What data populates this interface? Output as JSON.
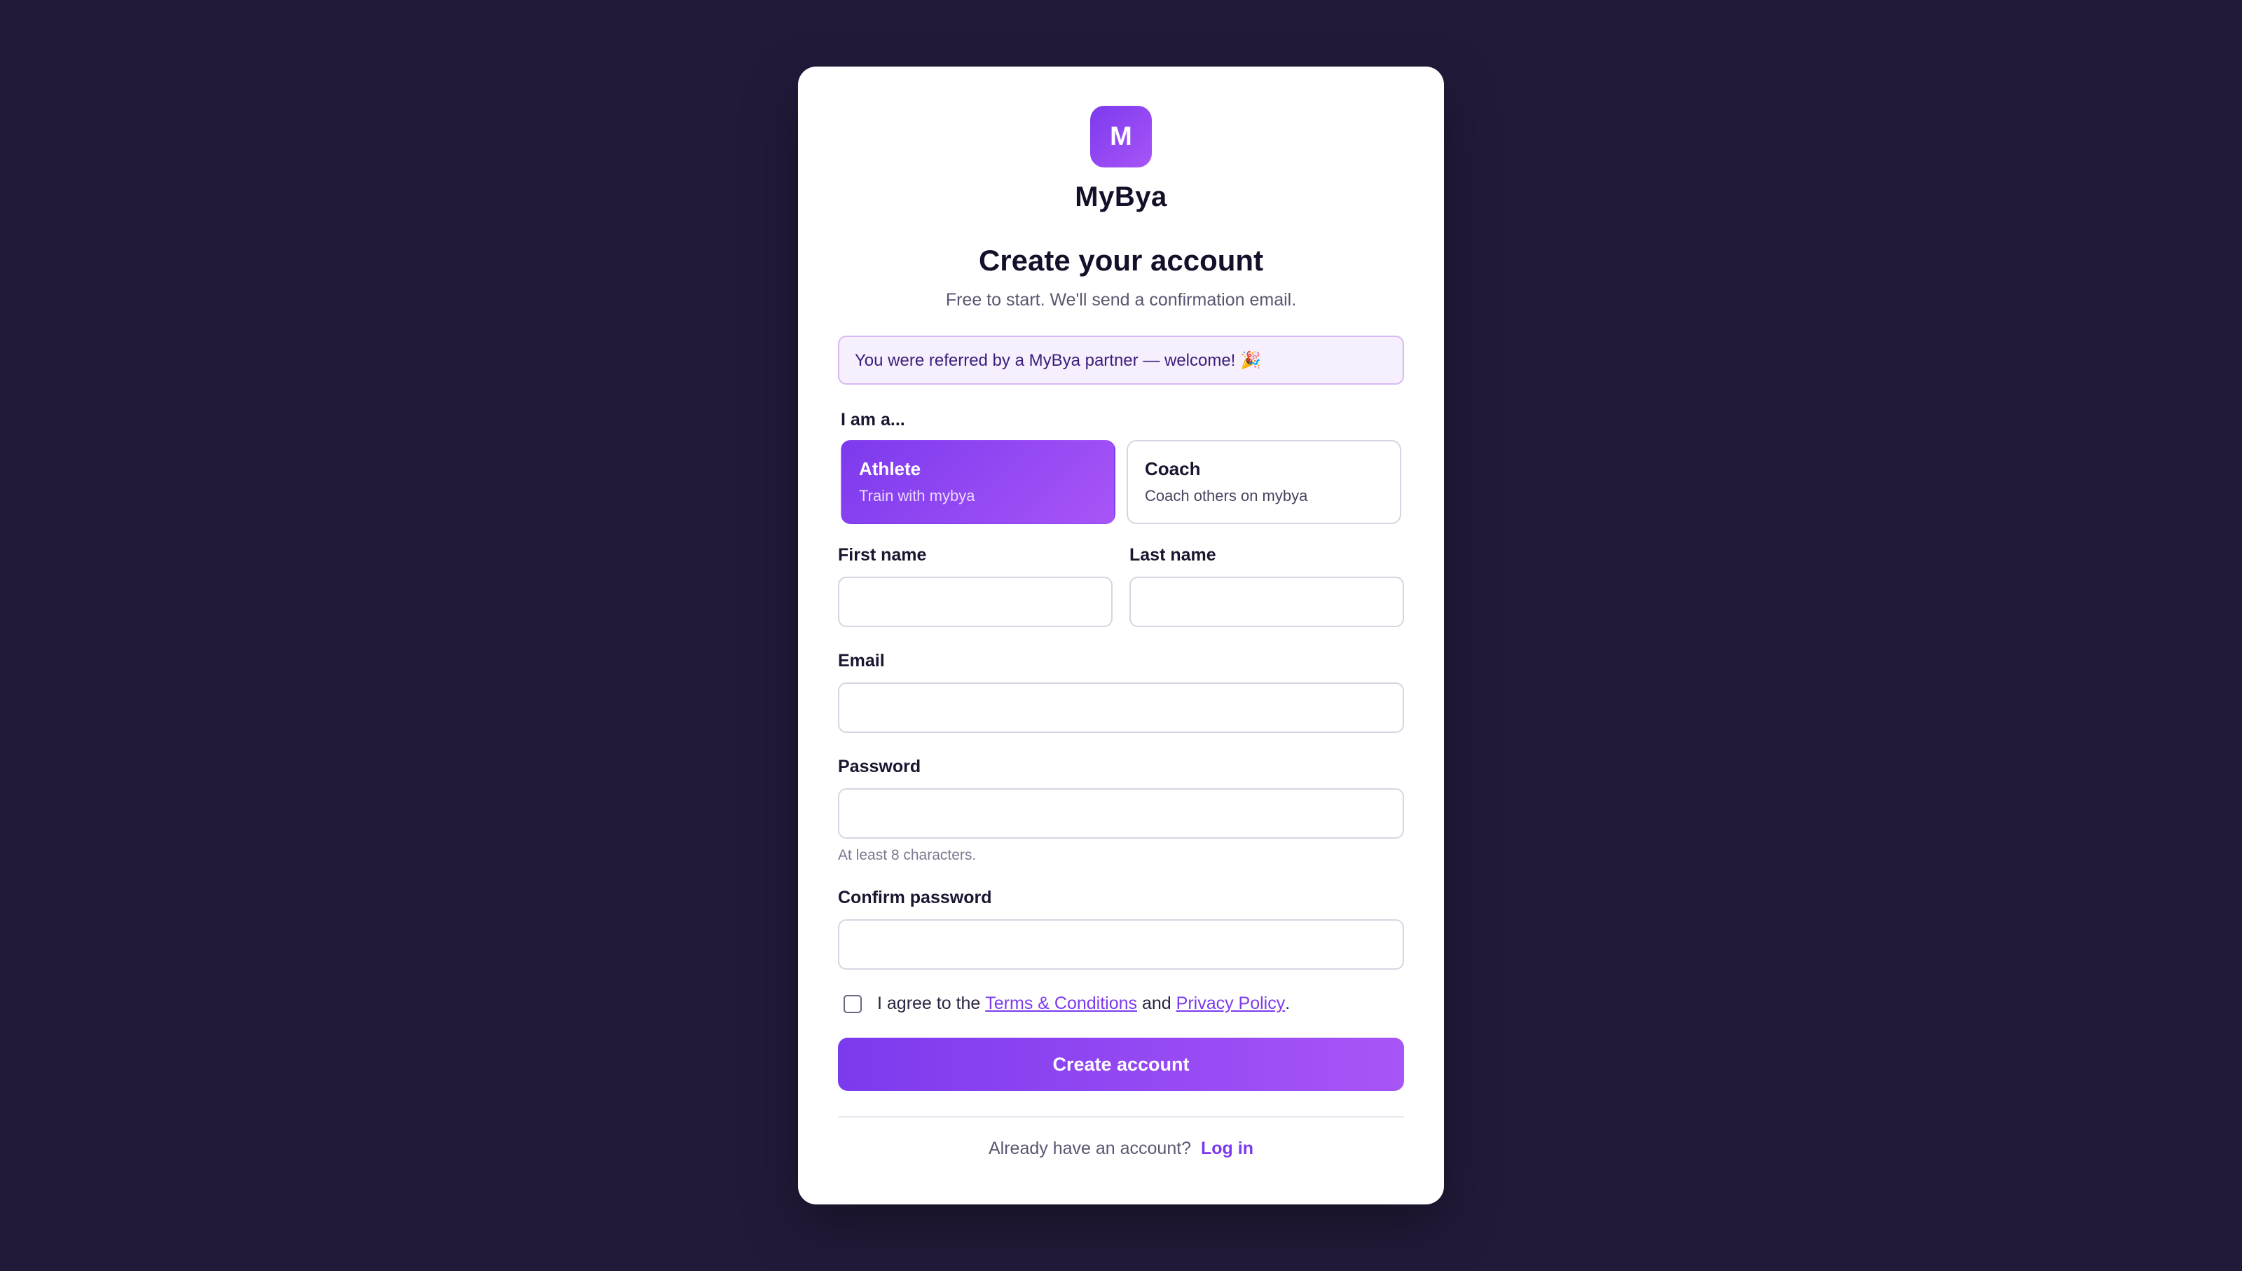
{
  "brand": {
    "logo_letter": "M",
    "name": "MyBya",
    "accent_color": "#7c3aed",
    "accent_color_end": "#a855f7"
  },
  "heading": {
    "title": "Create your account",
    "subtitle": "Free to start. We'll send a confirmation email."
  },
  "referral": {
    "message": "You were referred by a MyBya partner — welcome! 🎉"
  },
  "role": {
    "label": "I am a...",
    "options": [
      {
        "title": "Athlete",
        "description": "Train with mybya",
        "selected": true
      },
      {
        "title": "Coach",
        "description": "Coach others on mybya",
        "selected": false
      }
    ]
  },
  "form": {
    "first_name": {
      "label": "First name",
      "value": "",
      "placeholder": ""
    },
    "last_name": {
      "label": "Last name",
      "value": "",
      "placeholder": ""
    },
    "email": {
      "label": "Email",
      "value": "",
      "placeholder": ""
    },
    "password": {
      "label": "Password",
      "value": "",
      "placeholder": "",
      "hint": "At least 8 characters."
    },
    "confirm_password": {
      "label": "Confirm password",
      "value": "",
      "placeholder": ""
    }
  },
  "agreement": {
    "prefix": "I agree to the ",
    "terms_link": "Terms & Conditions",
    "middle": " and ",
    "privacy_link": "Privacy Policy",
    "suffix": ".",
    "checked": false
  },
  "submit": {
    "label": "Create account"
  },
  "footer": {
    "prompt": "Already have an account? ",
    "login_link": "Log in"
  }
}
